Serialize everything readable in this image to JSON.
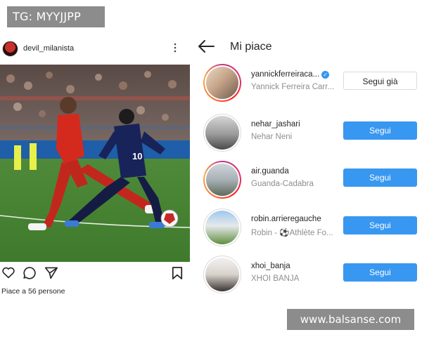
{
  "watermark_top": "TG: MYYJJPP",
  "watermark_bottom": "www.balsanse.com",
  "post": {
    "username": "devil_milanista",
    "more_icon": "more-vertical-icon",
    "photo_description_icon": "football-photo",
    "actions": [
      "heart-icon",
      "comment-icon",
      "share-icon",
      "bookmark-icon"
    ],
    "likes_text": "Piace a 56 persone"
  },
  "likes_panel": {
    "back_icon": "back-arrow-icon",
    "title": "Mi piace",
    "users": [
      {
        "username": "yannickferreiraca...",
        "full_name": "Yannick Ferreira Carr...",
        "verified": true,
        "button": "Segui già",
        "button_style": "following",
        "ring": true
      },
      {
        "username": "nehar_jashari",
        "full_name": "Nehar Neni",
        "verified": false,
        "button": "Segui",
        "button_style": "follow",
        "ring": false
      },
      {
        "username": "air.guanda",
        "full_name": "Guanda-Cadabra",
        "verified": false,
        "button": "Segui",
        "button_style": "follow",
        "ring": true
      },
      {
        "username": "robin.arrieregauche",
        "full_name": "Robin - ⚽Athlète Fo...",
        "verified": false,
        "button": "Segui",
        "button_style": "follow",
        "ring": false
      },
      {
        "username": "xhoi_banja",
        "full_name": "XHOI BANJA",
        "verified": false,
        "button": "Segui",
        "button_style": "follow",
        "ring": false
      }
    ]
  },
  "colors": {
    "follow_blue": "#3897f0",
    "text": "#262626",
    "muted": "#8e8e8e"
  }
}
